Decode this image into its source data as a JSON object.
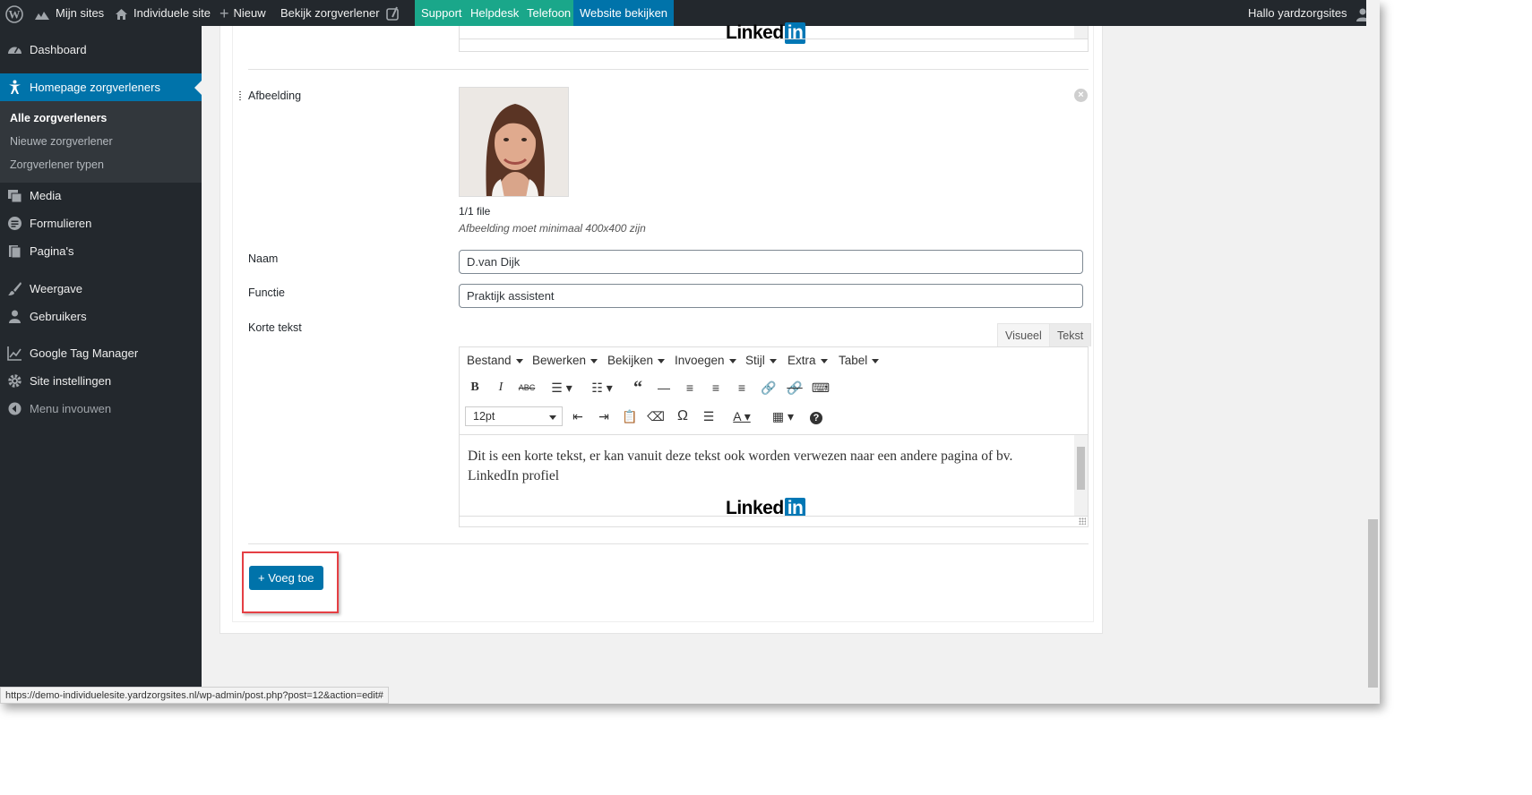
{
  "adminbar": {
    "my_sites": "Mijn sites",
    "site_name": "Individuele site",
    "new": "Nieuw",
    "view": "Bekijk zorgverlener",
    "support": "Support",
    "helpdesk": "Helpdesk",
    "phone": "Telefoon",
    "view_site": "Website bekijken",
    "greeting": "Hallo yardzorgsites"
  },
  "sidebar": {
    "dashboard": "Dashboard",
    "homepage": "Homepage zorgverleners",
    "sub": [
      "Alle zorgverleners",
      "Nieuwe zorgverlener",
      "Zorgverlener typen"
    ],
    "media": "Media",
    "forms": "Formulieren",
    "pages": "Pagina's",
    "appearance": "Weergave",
    "users": "Gebruikers",
    "gtm": "Google Tag Manager",
    "site_settings": "Site instellingen",
    "collapse": "Menu invouwen"
  },
  "field": {
    "image_label": "Afbeelding",
    "file_count": "1/1 file",
    "image_hint": "Afbeelding moet minimaal 400x400 zijn",
    "name_label": "Naam",
    "name_value": "D.van Dijk",
    "function_label": "Functie",
    "function_value": "Praktijk assistent",
    "short_text_label": "Korte tekst"
  },
  "editor": {
    "tab_visual": "Visueel",
    "tab_text": "Tekst",
    "menu": [
      "Bestand",
      "Bewerken",
      "Bekijken",
      "Invoegen",
      "Stijl",
      "Extra",
      "Tabel"
    ],
    "font_size": "12pt",
    "content": "Dit is een korte tekst, er kan vanuit deze tekst ook worden verwezen naar een andere pagina of bv. LinkedIn profiel",
    "linkedin_word": "Linked",
    "linkedin_in": "in"
  },
  "add_button": "+ Voeg toe",
  "status_url": "https://demo-individuelesite.yardzorgsites.nl/wp-admin/post.php?post=12&action=edit#",
  "colors": {
    "accent": "#0073aa",
    "bar_green": "#1aa78a",
    "highlight": "#e53f44",
    "admin_dark": "#23282d"
  }
}
